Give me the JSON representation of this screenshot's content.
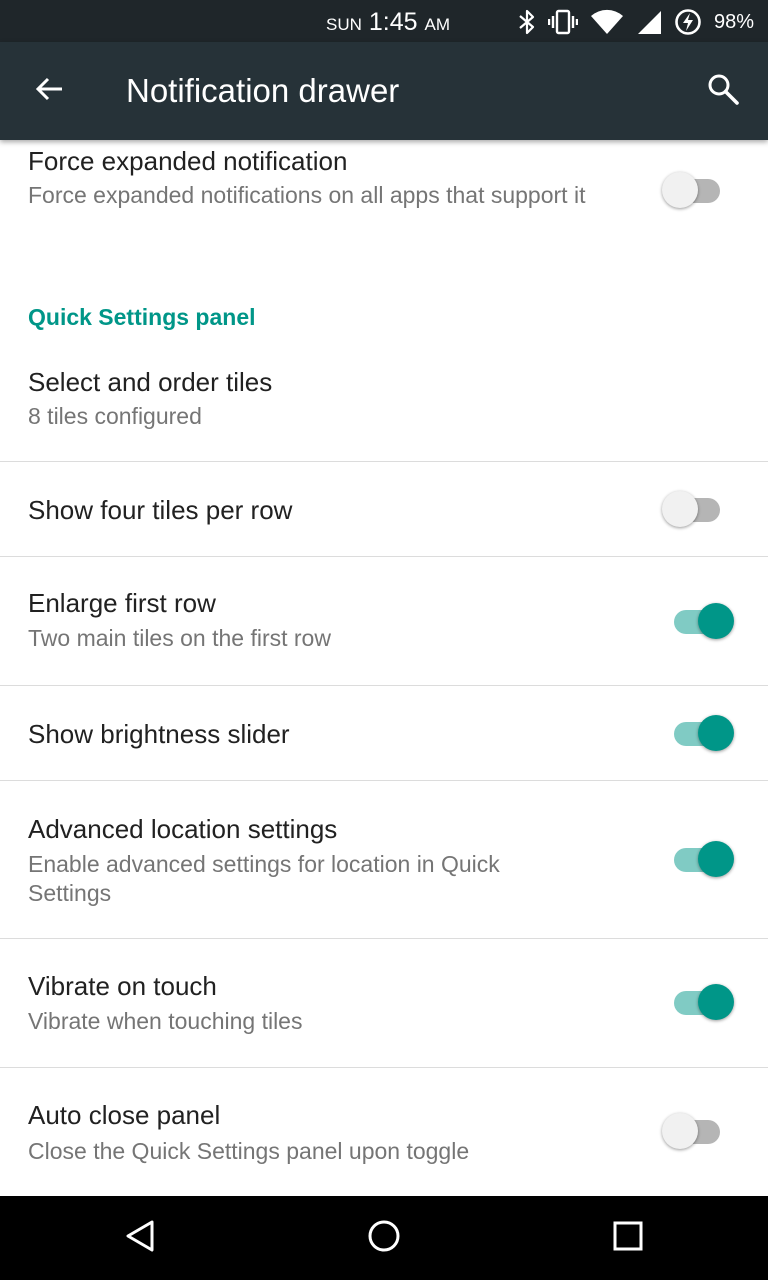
{
  "status_bar": {
    "day": "SUN",
    "time": "1:45",
    "ampm": "AM",
    "battery": "98%",
    "icons": [
      "bluetooth-icon",
      "vibrate-icon",
      "wifi-icon",
      "cell-signal-icon",
      "battery-charging-icon"
    ]
  },
  "app_bar": {
    "title": "Notification drawer",
    "back_icon": "arrow-back-icon",
    "search_icon": "search-icon"
  },
  "settings": {
    "force_expanded": {
      "title": "Force expanded notification",
      "summary": "Force expanded notifications on all apps that support it",
      "enabled": false
    },
    "category": "Quick Settings panel",
    "select_tiles": {
      "title": "Select and order tiles",
      "summary": "8 tiles configured"
    },
    "four_tiles": {
      "title": "Show four tiles per row",
      "enabled": false
    },
    "enlarge_first_row": {
      "title": "Enlarge first row",
      "summary": "Two main tiles on the first row",
      "enabled": true
    },
    "brightness_slider": {
      "title": "Show brightness slider",
      "enabled": true
    },
    "advanced_location": {
      "title": "Advanced location settings",
      "summary": "Enable advanced settings for location in Quick Settings",
      "enabled": true
    },
    "vibrate_on_touch": {
      "title": "Vibrate on touch",
      "summary": "Vibrate when touching tiles",
      "enabled": true
    },
    "auto_close": {
      "title": "Auto close panel",
      "summary": "Close the Quick Settings panel upon toggle",
      "enabled": false
    }
  },
  "colors": {
    "accent": "#009688",
    "accent_track": "#80cbc4",
    "app_bar": "#263238",
    "status_bar": "#1f262a"
  },
  "nav_bar": {
    "icons": [
      "back-triangle-icon",
      "home-circle-icon",
      "recents-square-icon"
    ]
  }
}
